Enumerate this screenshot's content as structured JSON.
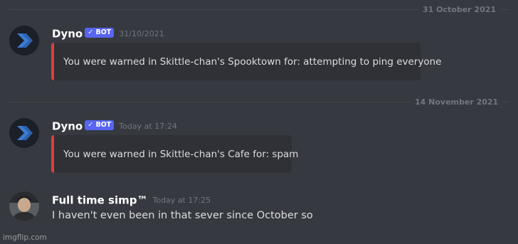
{
  "dividers": [
    {
      "date": "31 October 2021"
    },
    {
      "date": "14 November 2021"
    }
  ],
  "messages": [
    {
      "username": "Dyno",
      "bot_tag": "✓ BOT",
      "timestamp": "31/10/2021",
      "embed_text": "You were warned in Skittle-chan's Spooktown for: attempting to ping everyone",
      "avatar_icon": "dyno-logo-icon"
    },
    {
      "username": "Dyno",
      "bot_tag": "✓ BOT",
      "timestamp": "Today at 17:24",
      "embed_text": "You were warned in Skittle-chan's Cafe for: spam",
      "avatar_icon": "dyno-logo-icon"
    },
    {
      "username": "Full time simp™",
      "timestamp": "Today at 17:25",
      "content": "I haven't even been in that sever since October so",
      "avatar_icon": "user-avatar"
    }
  ],
  "watermark": "imgflip.com",
  "colors": {
    "background": "#36393f",
    "embed_background": "#2f3136",
    "embed_accent": "#e03e3e",
    "bot_tag": "#5865f2",
    "dyno_logo": "#3b7bd4"
  }
}
